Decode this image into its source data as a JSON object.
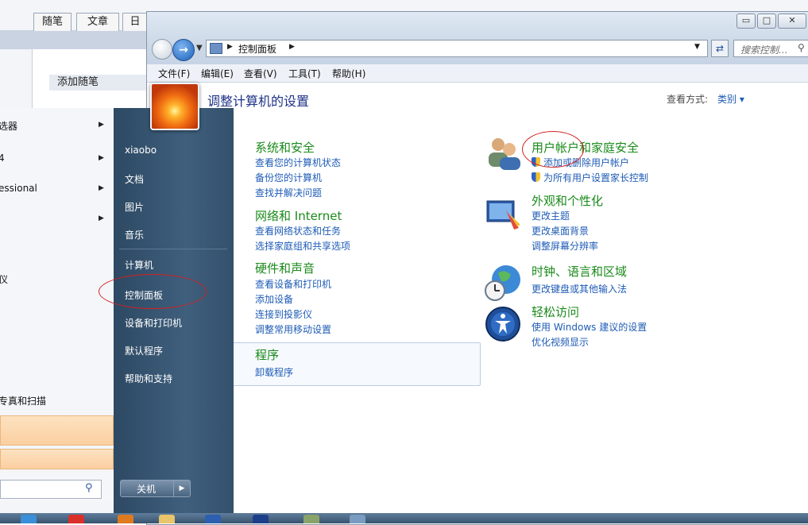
{
  "background_page": {
    "tabs": [
      "随笔",
      "文章",
      "日"
    ],
    "add_post_button": "添加随笔"
  },
  "control_panel": {
    "caption_buttons": {
      "minimize": "▭",
      "maximize": "□",
      "close": "✕"
    },
    "address": {
      "text": "控制面板"
    },
    "search": {
      "placeholder": "搜索控制..."
    },
    "menu": [
      "文件(F)",
      "编辑(E)",
      "查看(V)",
      "工具(T)",
      "帮助(H)"
    ],
    "heading": "调整计算机的设置",
    "view_by": {
      "label": "查看方式:",
      "value": "类别"
    },
    "categories_left": [
      {
        "title": "系统和安全",
        "links": [
          "查看您的计算机状态",
          "备份您的计算机",
          "查找并解决问题"
        ]
      },
      {
        "title": "网络和 Internet",
        "links": [
          "查看网络状态和任务",
          "选择家庭组和共享选项"
        ]
      },
      {
        "title": "硬件和声音",
        "links": [
          "查看设备和打印机",
          "添加设备",
          "连接到投影仪",
          "调整常用移动设置"
        ]
      },
      {
        "title": "程序",
        "links": [
          "卸载程序"
        ]
      }
    ],
    "categories_right": [
      {
        "title": "用户帐户和家庭安全",
        "links": [
          "添加或删除用户帐户",
          "为所有用户设置家长控制"
        ]
      },
      {
        "title": "外观和个性化",
        "links": [
          "更改主题",
          "更改桌面背景",
          "调整屏幕分辨率"
        ]
      },
      {
        "title": "时钟、语言和区域",
        "links": [
          "更改键盘或其他输入法"
        ]
      },
      {
        "title": "轻松访问",
        "links": [
          "使用 Windows 建议的设置",
          "优化视频显示"
        ]
      }
    ]
  },
  "start_menu": {
    "left_items": [
      "选器",
      "4",
      "essional",
      "",
      "仪",
      "专真和扫描"
    ],
    "right_items": [
      "xiaobo",
      "文档",
      "图片",
      "音乐",
      "计算机",
      "控制面板",
      "设备和打印机",
      "默认程序",
      "帮助和支持"
    ],
    "shutdown_label": "关机"
  },
  "colors": {
    "category_title": "#1a8a1a",
    "link": "#1e5bb6",
    "heading": "#1e3287",
    "annotation": "#d42020"
  }
}
